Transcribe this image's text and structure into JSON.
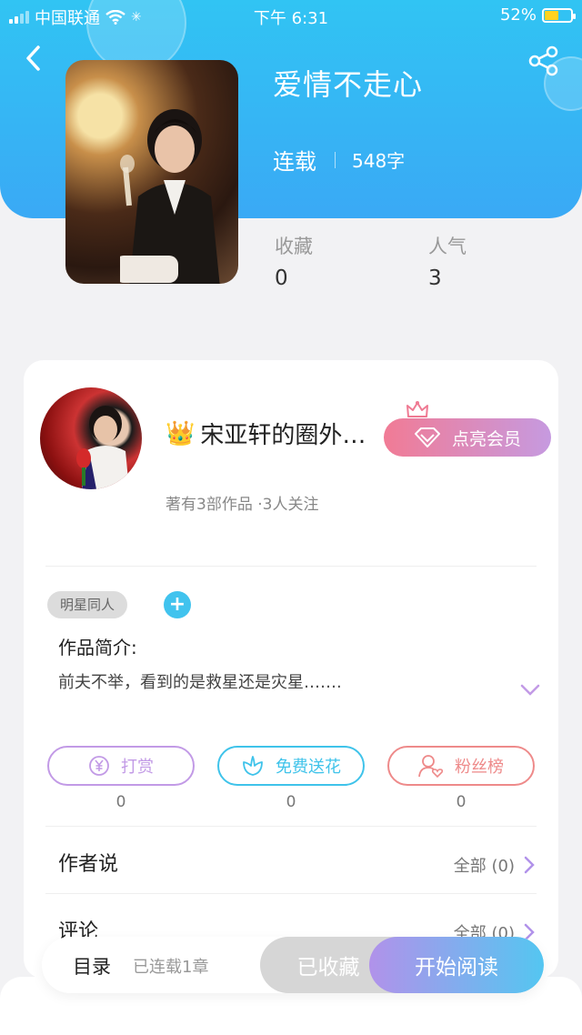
{
  "status_bar": {
    "carrier": "中国联通",
    "time": "下午 6:31",
    "battery": "52%",
    "battery_level": 0.52
  },
  "book": {
    "title": "爱情不走心",
    "status": "连载",
    "word_count": "548字",
    "favorites_label": "收藏",
    "favorites_value": "0",
    "popularity_label": "人气",
    "popularity_value": "3"
  },
  "author": {
    "name": "宋亚轩的圈外…",
    "crown_emoji": "👑",
    "sub": "著有3部作品 ·3人关注",
    "vip_button": "点亮会员"
  },
  "tags": [
    "明星同人"
  ],
  "intro": {
    "heading": "作品简介:",
    "text": "前夫不举，看到的是救星还是灾星……."
  },
  "actions": [
    {
      "label": "打赏",
      "count": "0",
      "color": "#c29ae6",
      "icon": "yen-coin-icon"
    },
    {
      "label": "免费送花",
      "count": "0",
      "color": "#3fc3ea",
      "icon": "flower-icon"
    },
    {
      "label": "粉丝榜",
      "count": "0",
      "color": "#ee8a8a",
      "icon": "fan-user-icon"
    }
  ],
  "sections": {
    "author_says": "作者说",
    "author_says_all": "全部 (0)",
    "comments": "评论",
    "comments_all": "全部 (0)"
  },
  "bottom_bar": {
    "toc": "目录",
    "toc_sub": "已连载1章",
    "favorited": "已收藏",
    "start_reading": "开始阅读"
  },
  "colors": {
    "header_gradient": [
      "#31c4f3",
      "#3aa9f5"
    ],
    "accent_purple": "#b192ea",
    "accent_cyan": "#54c6f1"
  }
}
